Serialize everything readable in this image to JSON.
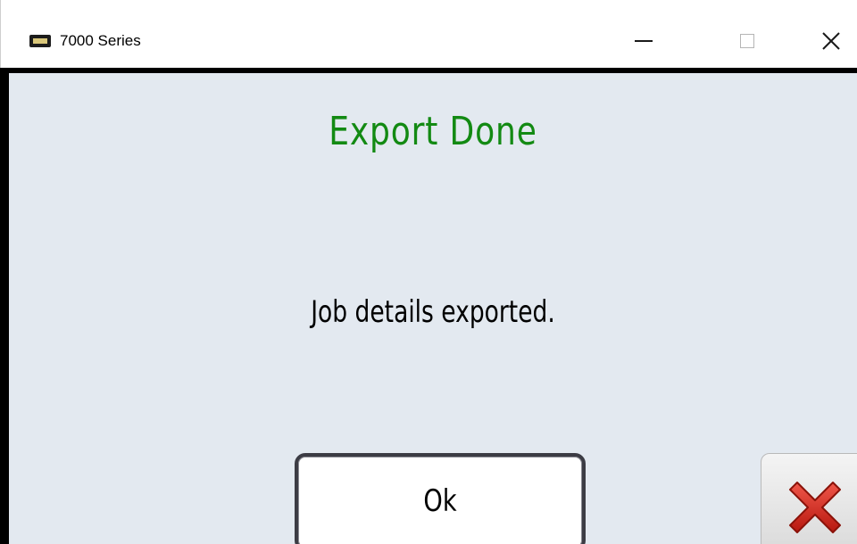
{
  "window": {
    "title": "7000 Series",
    "app_icon": "device-icon",
    "controls": {
      "minimize_icon": "minimize-icon",
      "maximize_icon": "maximize-icon",
      "close_icon": "close-icon"
    }
  },
  "dialog": {
    "title": "Export Done",
    "title_color": "#138a13",
    "message": "Job details exported.",
    "ok_label": "Ok",
    "cancel_icon": "red-x-icon",
    "cancel_color": "#d42a1f",
    "background_color": "#e3e9f0"
  }
}
